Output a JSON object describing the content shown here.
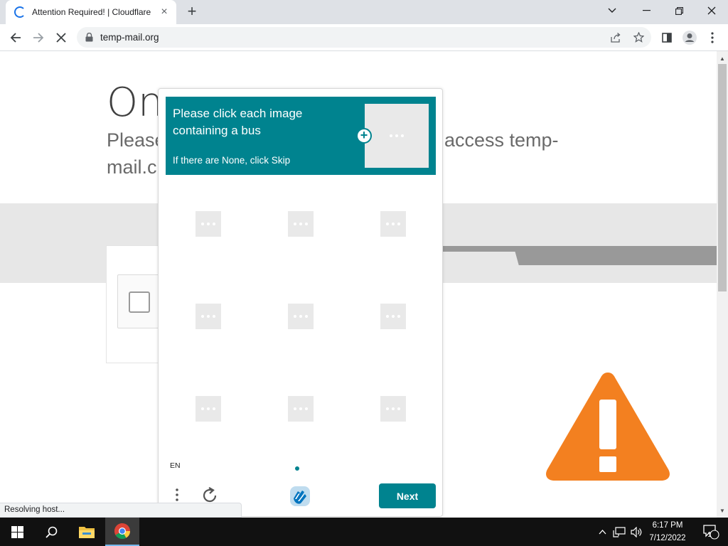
{
  "browser": {
    "tab_title": "Attention Required! | Cloudflare",
    "tab_close_icon": "×",
    "new_tab_icon": "+",
    "url": "temp-mail.org",
    "status_text": "Resolving host..."
  },
  "page": {
    "heading": "On",
    "subtitle_lead": "Please",
    "subtitle_tail": "access temp-",
    "subtitle_line2": "mail.c",
    "warning_color": "#f38020"
  },
  "captcha": {
    "prompt": "Please click each image containing a bus",
    "hint": "If there are None, click Skip",
    "expand_icon": "+",
    "language": "EN",
    "next_label": "Next",
    "accent_color": "#00838f",
    "grid": [
      {
        "label": "image-1"
      },
      {
        "label": "image-2"
      },
      {
        "label": "image-3"
      },
      {
        "label": "image-4"
      },
      {
        "label": "image-5"
      },
      {
        "label": "image-6"
      },
      {
        "label": "image-7"
      },
      {
        "label": "image-8"
      },
      {
        "label": "image-9"
      }
    ]
  },
  "taskbar": {
    "time": "6:17 PM",
    "date": "7/12/2022",
    "notification_count": "1"
  }
}
